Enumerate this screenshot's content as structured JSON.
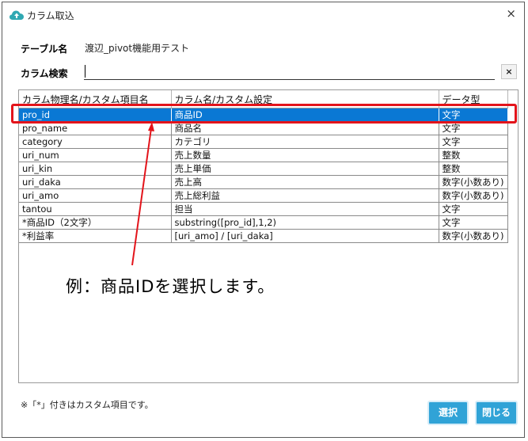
{
  "window": {
    "title": "カラム取込",
    "close_glyph": "×"
  },
  "table_name": {
    "label": "テーブル名",
    "value": "渡辺_pivot機能用テスト"
  },
  "search": {
    "label": "カラム検索",
    "value": "",
    "clear_glyph": "×"
  },
  "grid": {
    "headers": [
      "カラム物理名/カスタム項目名",
      "カラム名/カスタム設定",
      "データ型"
    ],
    "selected_row": 0,
    "rows": [
      [
        "pro_id",
        "商品ID",
        "文字"
      ],
      [
        "pro_name",
        "商品名",
        "文字"
      ],
      [
        "category",
        "カテゴリ",
        "文字"
      ],
      [
        "uri_num",
        "売上数量",
        "整数"
      ],
      [
        "uri_kin",
        "売上単価",
        "整数"
      ],
      [
        "uri_daka",
        "売上高",
        "数字(小数あり)"
      ],
      [
        "uri_amo",
        "売上総利益",
        "数字(小数あり)"
      ],
      [
        "tantou",
        "担当",
        "文字"
      ],
      [
        "*商品ID（2文字）",
        "substring([pro_id],1,2)",
        "文字"
      ],
      [
        "*利益率",
        "[uri_amo] / [uri_daka]",
        "数字(小数あり)"
      ]
    ]
  },
  "annotation": {
    "text": "例：商品IDを選択します。",
    "color": "#e3141b"
  },
  "footnote": "※「*」付きはカスタム項目です。",
  "buttons": {
    "select": "選択",
    "close": "閉じる"
  },
  "colors": {
    "accent": "#30a3d7",
    "selection": "#0a78d4",
    "highlight": "#e3141b"
  }
}
